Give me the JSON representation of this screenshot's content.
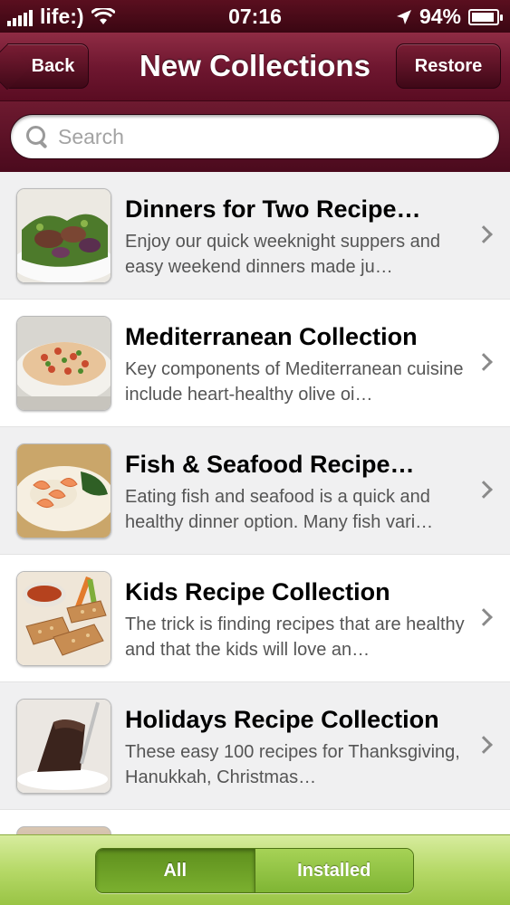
{
  "status_bar": {
    "carrier": "life:)",
    "time": "07:16",
    "battery": "94%",
    "battery_level": 0.94,
    "icons": [
      "signal-bars-icon",
      "wifi-icon",
      "location-arrow-icon",
      "battery-charging-icon"
    ]
  },
  "nav": {
    "title": "New Collections",
    "back_label": "Back",
    "restore_label": "Restore"
  },
  "search": {
    "placeholder": "Search",
    "value": ""
  },
  "collections": [
    {
      "title": "Dinners for Two Recipe Collection",
      "title_display": "Dinners for Two Recipe…",
      "description": "Enjoy our quick weeknight suppers and easy weekend dinners made ju…",
      "thumb": "grilled-steak-salad"
    },
    {
      "title": "Mediterranean Collection",
      "title_display": "Mediterranean Collection",
      "description": "Key components of Mediterranean cuisine include heart-healthy olive oi…",
      "thumb": "pasta-bowl"
    },
    {
      "title": "Fish & Seafood Recipe Collection",
      "title_display": "Fish & Seafood Recipe…",
      "description": "Eating fish and seafood is a quick and healthy dinner option. Many fish vari…",
      "thumb": "shrimp-plate"
    },
    {
      "title": "Kids Recipe Collection",
      "title_display": "Kids Recipe Collection",
      "description": "The trick is finding recipes that are healthy and that the kids will love an…",
      "thumb": "chicken-tenders"
    },
    {
      "title": "Holidays Recipe Collection",
      "title_display": "Holidays Recipe Collection",
      "description": "These easy 100 recipes for Thanksgiving, Hanukkah, Christmas…",
      "thumb": "chocolate-cake-slice"
    }
  ],
  "toolbar": {
    "segments": [
      {
        "label": "All",
        "selected": true
      },
      {
        "label": "Installed",
        "selected": false
      }
    ]
  },
  "colors": {
    "nav_maroon": "#6f1730",
    "toolbar_green": "#b6d968",
    "segment_active": "#5e8f1d"
  }
}
